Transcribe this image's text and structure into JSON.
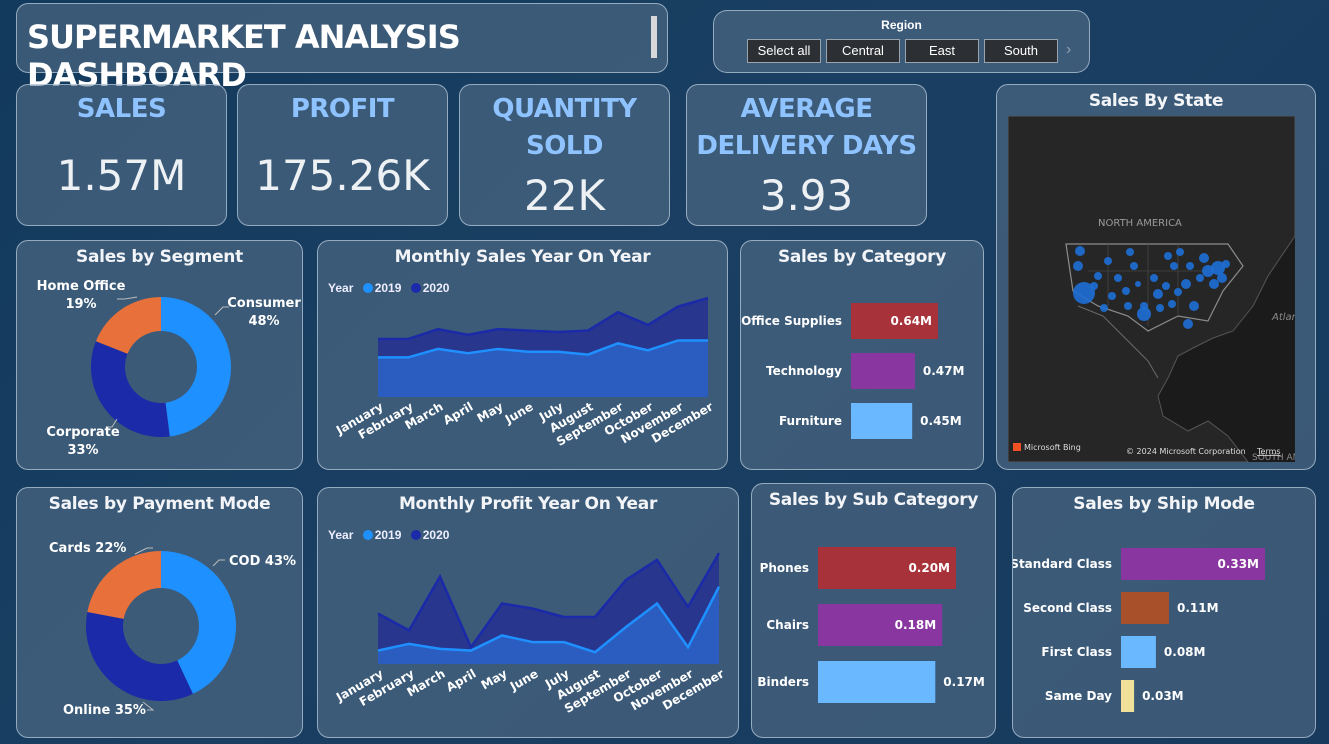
{
  "header": {
    "title": "SUPERMARKET ANALYSIS DASHBOARD"
  },
  "slicer": {
    "title": "Region",
    "options": [
      "Select all",
      "Central",
      "East",
      "South"
    ]
  },
  "kpis": {
    "sales": {
      "label": "SALES",
      "value": "1.57M"
    },
    "profit": {
      "label": "PROFIT",
      "value": "175.26K"
    },
    "quantity": {
      "label_line1": "QUANTITY",
      "label_line2": "SOLD",
      "value": "22K"
    },
    "delivery": {
      "label_line1": "AVERAGE",
      "label_line2": "DELIVERY DAYS",
      "value": "3.93"
    }
  },
  "map": {
    "title": "Sales By State",
    "continent_label": "NORTH AMERICA",
    "ocean_label": "Atlant",
    "south_label": "SOUTH AME",
    "bing": "Microsoft Bing",
    "copyright": "© 2024 Microsoft Corporation",
    "terms": "Terms"
  },
  "colors": {
    "c2019": "#1e90ff",
    "c2020": "#1a2aa8",
    "orange": "#e8703a",
    "red": "#a8323a",
    "purple": "#8a36a0",
    "lightblue": "#6ab8ff",
    "brown": "#a8502a",
    "yellow": "#f0e09a"
  },
  "charts": [
    {
      "id": "segment",
      "title": "Sales by Segment",
      "type": "pie",
      "slices": [
        {
          "name": "Consumer",
          "pct": "48%",
          "value": 48,
          "color": "#1e90ff"
        },
        {
          "name": "Corporate",
          "pct": "33%",
          "value": 33,
          "color": "#1a2aa8"
        },
        {
          "name": "Home Office",
          "pct": "19%",
          "value": 19,
          "color": "#e8703a"
        }
      ]
    },
    {
      "id": "payment",
      "title": "Sales by Payment Mode",
      "type": "pie",
      "slices": [
        {
          "name": "COD",
          "pct": "43%",
          "value": 43,
          "color": "#1e90ff"
        },
        {
          "name": "Online",
          "pct": "35%",
          "value": 35,
          "color": "#1a2aa8"
        },
        {
          "name": "Cards",
          "pct": "22%",
          "value": 22,
          "color": "#e8703a"
        }
      ]
    },
    {
      "id": "monthly_sales",
      "title": "Monthly Sales Year On Year",
      "type": "area",
      "legend_label": "Year",
      "categories": [
        "January",
        "February",
        "March",
        "April",
        "May",
        "June",
        "July",
        "August",
        "September",
        "October",
        "November",
        "December"
      ],
      "series": [
        {
          "name": "2019",
          "values": [
            28,
            28,
            34,
            31,
            34,
            32,
            32,
            30,
            38,
            33,
            40,
            40
          ]
        },
        {
          "name": "2020",
          "values": [
            41,
            41,
            48,
            44,
            48,
            47,
            46,
            47,
            60,
            51,
            64,
            70
          ]
        }
      ],
      "ylim": [
        0,
        75
      ]
    },
    {
      "id": "monthly_profit",
      "title": "Monthly Profit Year On Year",
      "type": "area",
      "legend_label": "Year",
      "categories": [
        "January",
        "February",
        "March",
        "April",
        "May",
        "June",
        "July",
        "August",
        "September",
        "October",
        "November",
        "December"
      ],
      "series": [
        {
          "name": "2019",
          "values": [
            8,
            12,
            9,
            8,
            17,
            13,
            13,
            7,
            22,
            36,
            10,
            46
          ]
        },
        {
          "name": "2020",
          "values": [
            30,
            20,
            52,
            10,
            36,
            33,
            28,
            28,
            50,
            62,
            34,
            66
          ]
        }
      ],
      "ylim": [
        0,
        75
      ]
    },
    {
      "id": "category",
      "title": "Sales by Category",
      "type": "bar",
      "categories": [
        "Office Supplies",
        "Technology",
        "Furniture"
      ],
      "values": [
        0.64,
        0.47,
        0.45
      ],
      "labels": [
        "0.64M",
        "0.47M",
        "0.45M"
      ],
      "colors": [
        "#a8323a",
        "#8a36a0",
        "#6ab8ff"
      ],
      "max": 0.64
    },
    {
      "id": "subcategory",
      "title": "Sales by Sub Category",
      "type": "bar",
      "categories": [
        "Phones",
        "Chairs",
        "Binders"
      ],
      "values": [
        0.2,
        0.18,
        0.17
      ],
      "labels": [
        "0.20M",
        "0.18M",
        "0.17M"
      ],
      "colors": [
        "#a8323a",
        "#8a36a0",
        "#6ab8ff"
      ],
      "max": 0.2
    },
    {
      "id": "shipmode",
      "title": "Sales by Ship Mode",
      "type": "bar",
      "categories": [
        "Standard Class",
        "Second Class",
        "First Class",
        "Same Day"
      ],
      "values": [
        0.33,
        0.11,
        0.08,
        0.03
      ],
      "labels": [
        "0.33M",
        "0.11M",
        "0.08M",
        "0.03M"
      ],
      "colors": [
        "#8a36a0",
        "#a8502a",
        "#6ab8ff",
        "#f0e09a"
      ],
      "max": 0.33
    }
  ]
}
